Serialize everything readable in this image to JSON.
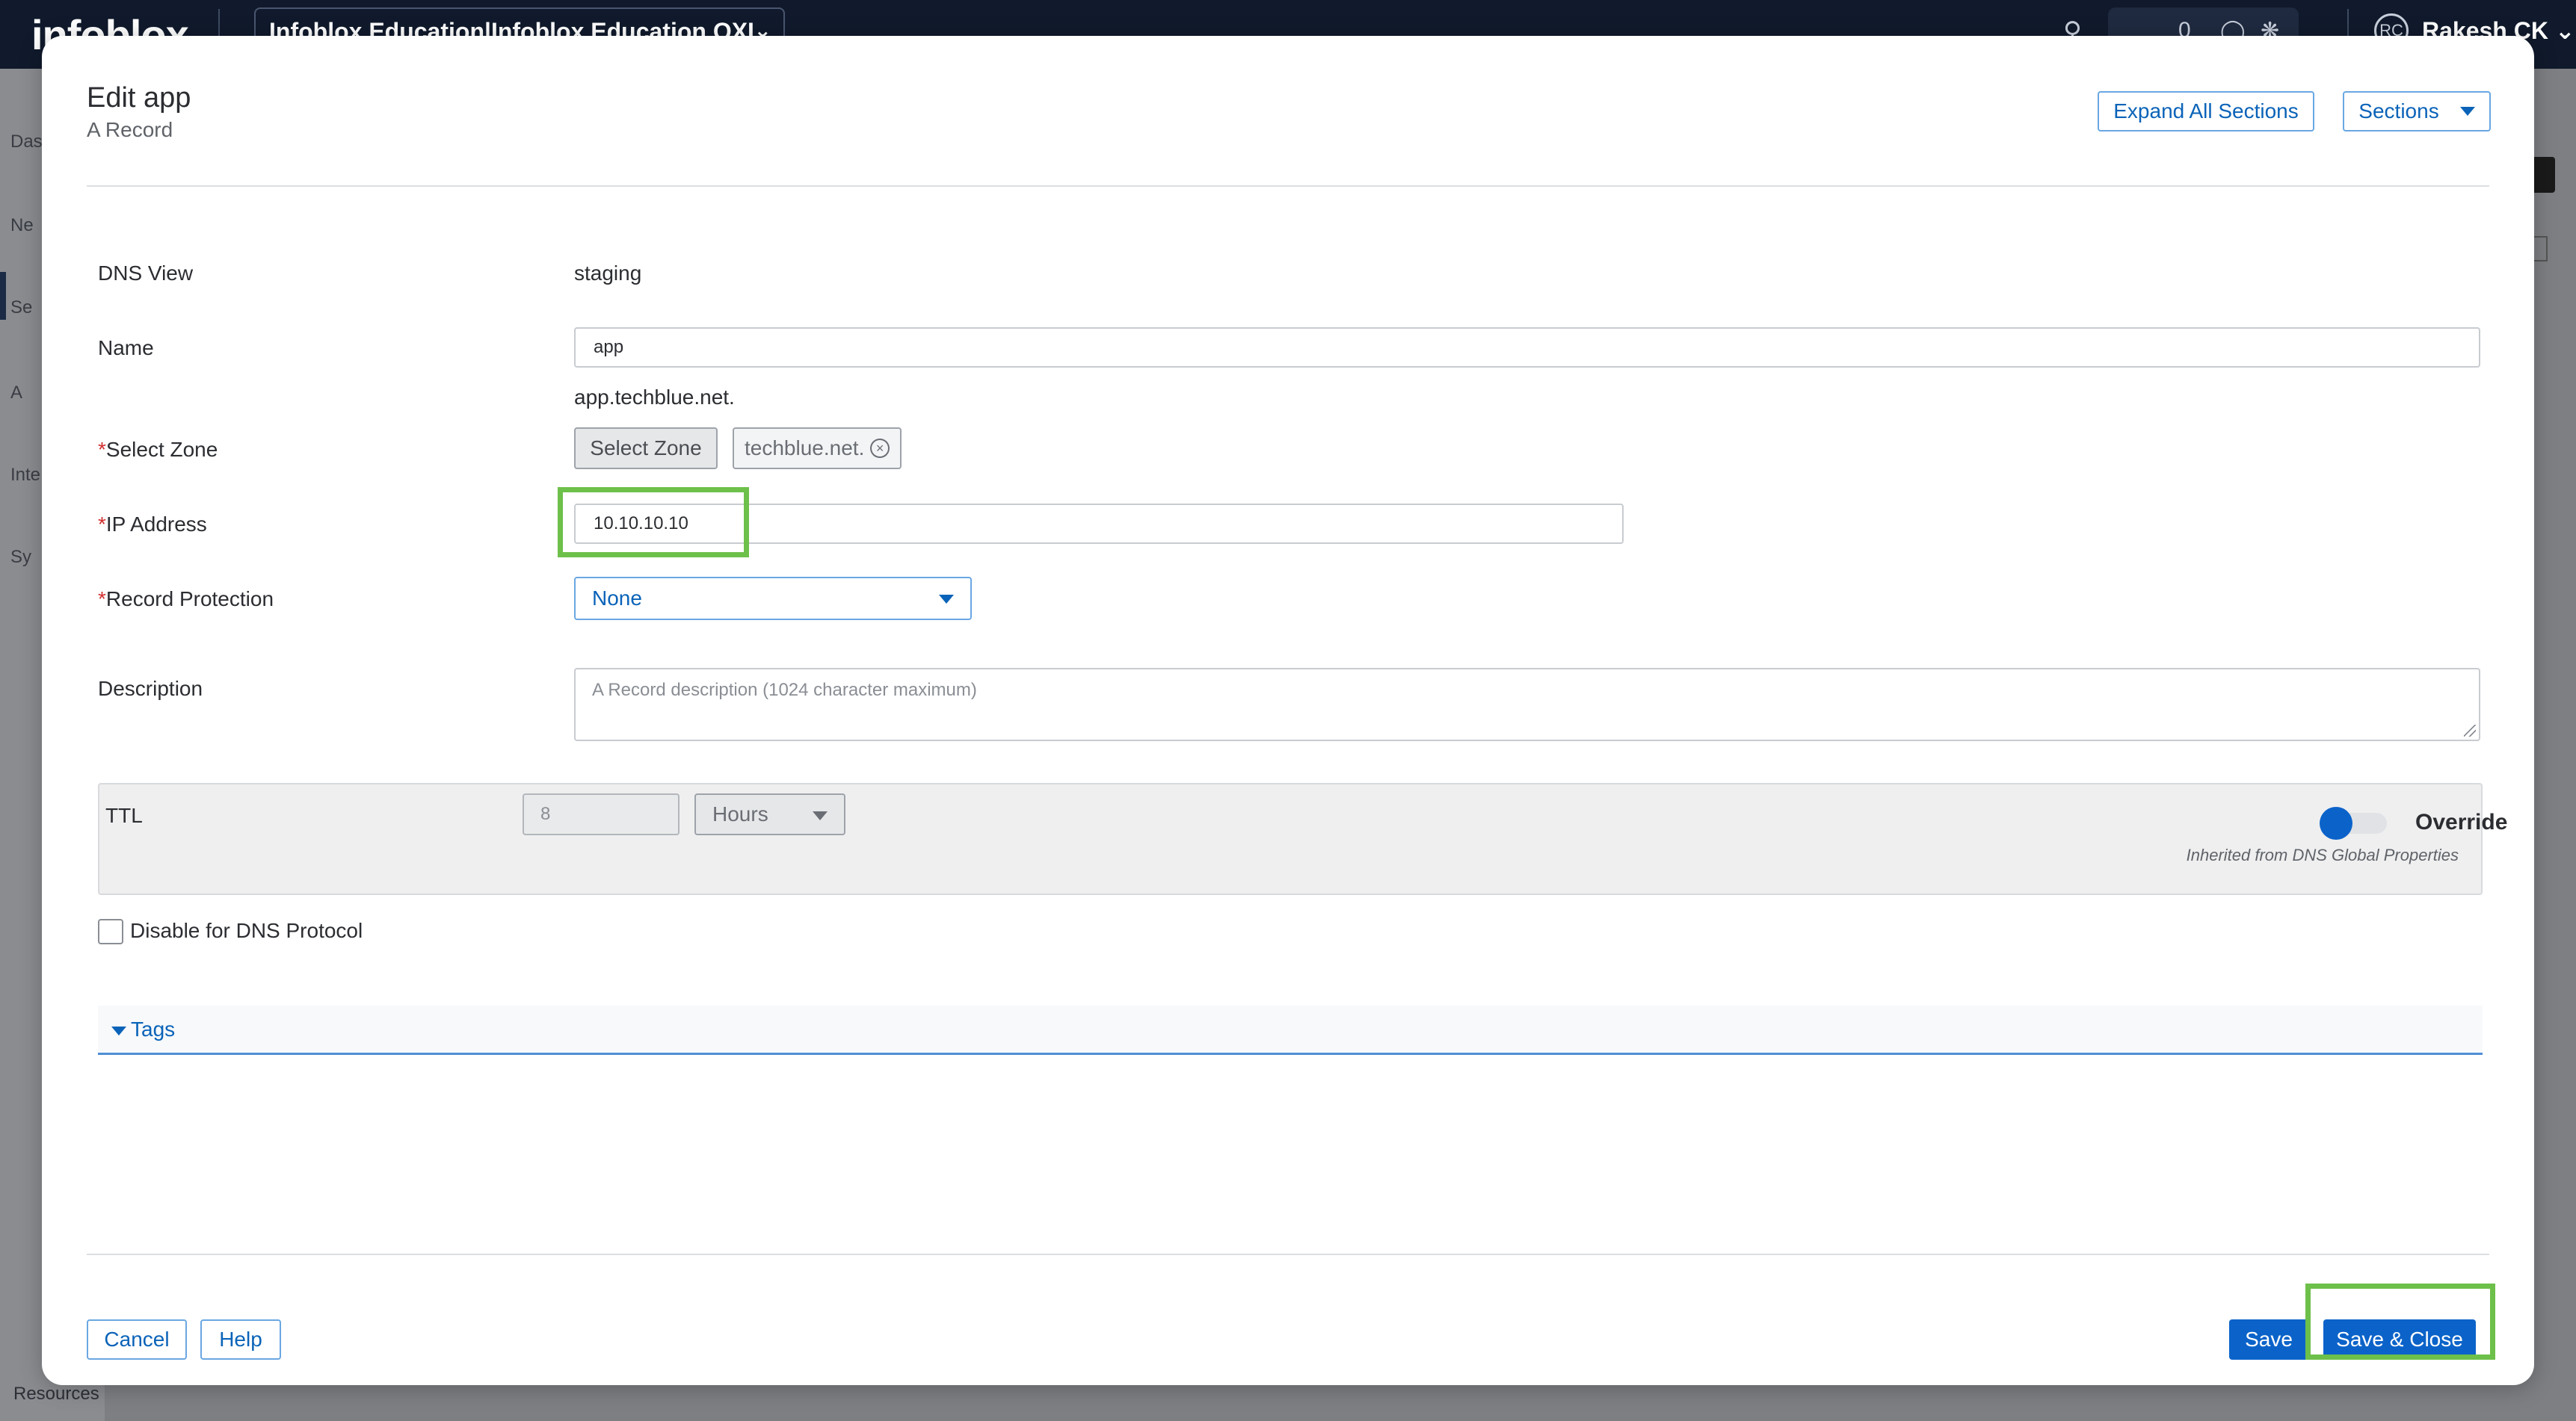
{
  "background": {
    "logo": "infoblox",
    "account": "Infoblox Education|Infoblox Education OXL",
    "notification_count": "0",
    "user_initials": "RC",
    "user_name": "Rakesh CK",
    "sidebar_fragments": [
      "Das",
      "Ne",
      "Se",
      "A",
      "Inte",
      "Sy",
      "Resources"
    ]
  },
  "modal": {
    "title": "Edit app",
    "subtitle": "A Record",
    "expand_all_label": "Expand All Sections",
    "sections_label": "Sections"
  },
  "form": {
    "dns_view": {
      "label": "DNS View",
      "value": "staging"
    },
    "name": {
      "label": "Name",
      "value": "app",
      "fqdn": "app.techblue.net."
    },
    "select_zone": {
      "required_mark": "*",
      "label": "Select Zone",
      "button_label": "Select Zone",
      "chip_label": "techblue.net."
    },
    "ip_address": {
      "required_mark": "*",
      "label": "IP Address",
      "value": "10.10.10.10"
    },
    "record_protection": {
      "required_mark": "*",
      "label": "Record Protection",
      "value": "None"
    },
    "description": {
      "label": "Description",
      "placeholder": "A Record description (1024 character maximum)"
    },
    "ttl": {
      "label": "TTL",
      "value": "8",
      "unit": "Hours",
      "override_label": "Override",
      "inherited_note": "Inherited from DNS Global Properties"
    },
    "disable_dns": {
      "label": "Disable for DNS Protocol",
      "checked": false
    },
    "tags": {
      "label": "Tags"
    }
  },
  "footer": {
    "cancel_label": "Cancel",
    "help_label": "Help",
    "save_label": "Save",
    "save_close_label": "Save & Close"
  },
  "colors": {
    "primary": "#0b63c9",
    "highlight": "#6dc04a",
    "required": "#d32f2f"
  }
}
